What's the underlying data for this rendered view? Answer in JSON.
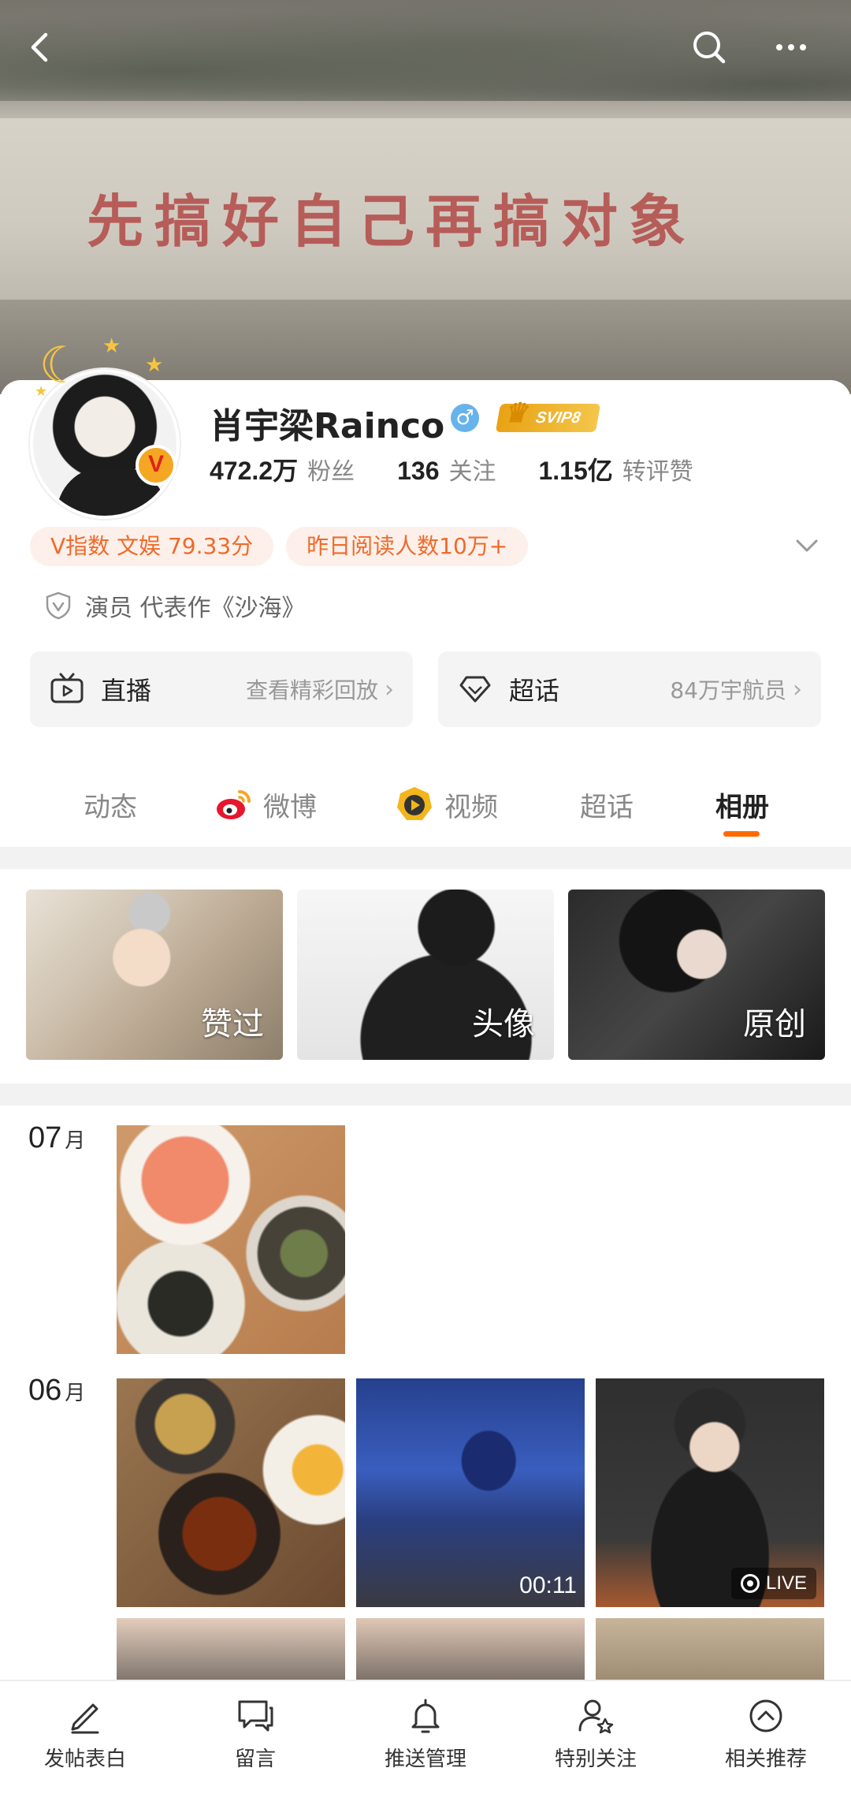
{
  "banner": {
    "slogan": "先搞好自己再搞对象"
  },
  "topbar": {
    "back_icon": "chevron-left-icon",
    "search_icon": "search-icon",
    "more_icon": "more-dots-icon"
  },
  "profile": {
    "username": "肖宇梁Rainco",
    "gender_symbol": "♂",
    "vip_badge": "SVIP8",
    "verified_badge": "V",
    "stats": [
      {
        "num": "472.2万",
        "label": "粉丝"
      },
      {
        "num": "136",
        "label": "关注"
      },
      {
        "num": "1.15亿",
        "label": "转评赞"
      }
    ],
    "tags": [
      "V指数 文娱 79.33分",
      "昨日阅读人数10万+"
    ],
    "verification": "演员 代表作《沙海》"
  },
  "quick_links": [
    {
      "title": "直播",
      "subtitle": "查看精彩回放",
      "arrow": "›",
      "icon": "tv-icon"
    },
    {
      "title": "超话",
      "subtitle": "84万宇航员",
      "arrow": "›",
      "icon": "diamond-icon"
    }
  ],
  "tabs": [
    {
      "label": "动态",
      "active": false
    },
    {
      "label": "微博",
      "active": false,
      "icon": "weibo-logo-icon"
    },
    {
      "label": "视频",
      "active": false,
      "icon": "video-badge-icon"
    },
    {
      "label": "超话",
      "active": false
    },
    {
      "label": "相册",
      "active": true
    }
  ],
  "albums": [
    {
      "label": "赞过"
    },
    {
      "label": "头像"
    },
    {
      "label": "原创"
    }
  ],
  "timeline": [
    {
      "month": "07",
      "unit": "月"
    },
    {
      "month": "06",
      "unit": "月"
    }
  ],
  "media": {
    "video_duration": "00:11",
    "live_label": "LIVE"
  },
  "bottom_bar": [
    {
      "label": "发帖表白",
      "icon": "pen-icon"
    },
    {
      "label": "留言",
      "icon": "message-icon"
    },
    {
      "label": "推送管理",
      "icon": "bell-settings-icon"
    },
    {
      "label": "特别关注",
      "icon": "user-star-icon"
    },
    {
      "label": "相关推荐",
      "icon": "arrow-up-circle-icon"
    }
  ],
  "colors": {
    "accent": "#ff6a00",
    "tag_bg": "#fdf0ea",
    "tag_text": "#ef6a2a",
    "vip_gold": "#e9a214"
  }
}
